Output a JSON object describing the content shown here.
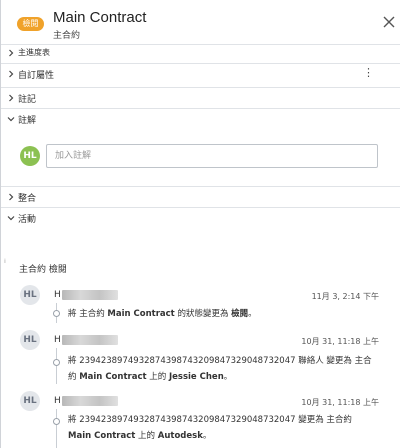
{
  "header": {
    "badge": "檢閱",
    "title": "Main Contract",
    "subtitle": "主合約"
  },
  "sections": {
    "main_schedule": "主進度表",
    "custom_props": "自訂屬性",
    "notes": "註記",
    "comments": "註解",
    "integration": "整合",
    "activity": "活動"
  },
  "comments": {
    "avatar": "HL",
    "placeholder": "加入註解"
  },
  "activity": {
    "title": "主合約 檢閱",
    "entries": [
      {
        "avatar": "HL",
        "name": "H",
        "time": "11月 3, 2:14 下午",
        "line1_pre": "將 主合約 ",
        "line1_bold": "Main Contract",
        "line1_mid": " 的狀態變更為 ",
        "line1_bold2": "檢閱",
        "line1_post": "。"
      },
      {
        "avatar": "HL",
        "name": "H",
        "time": "10月 31, 11:18 上午",
        "line1": "將 2394238974932874398743209847329048732047 聯絡人 變更為 主合",
        "line2_pre": "約 ",
        "line2_bold": "Main Contract",
        "line2_mid": " 上的 ",
        "line2_bold2": "Jessie Chen",
        "line2_post": "。"
      },
      {
        "avatar": "HL",
        "name": "H",
        "time": "10月 31, 11:18 上午",
        "line1": "將 2394238974932874398743209847329048732047 變更為 主合約",
        "line2_bold": "Main Contract",
        "line2_mid": " 上的 ",
        "line2_bold2": "Autodesk",
        "line2_post": "。"
      }
    ]
  },
  "colors": {
    "badge": "#f0a22a",
    "avatar_green": "#8cc152",
    "avatar_grey": "#e3e6ea"
  },
  "icons": {
    "close": "close-icon",
    "chevron_right": "chevron-right-icon",
    "chevron_down": "chevron-down-icon",
    "more": "more-vertical-icon"
  }
}
